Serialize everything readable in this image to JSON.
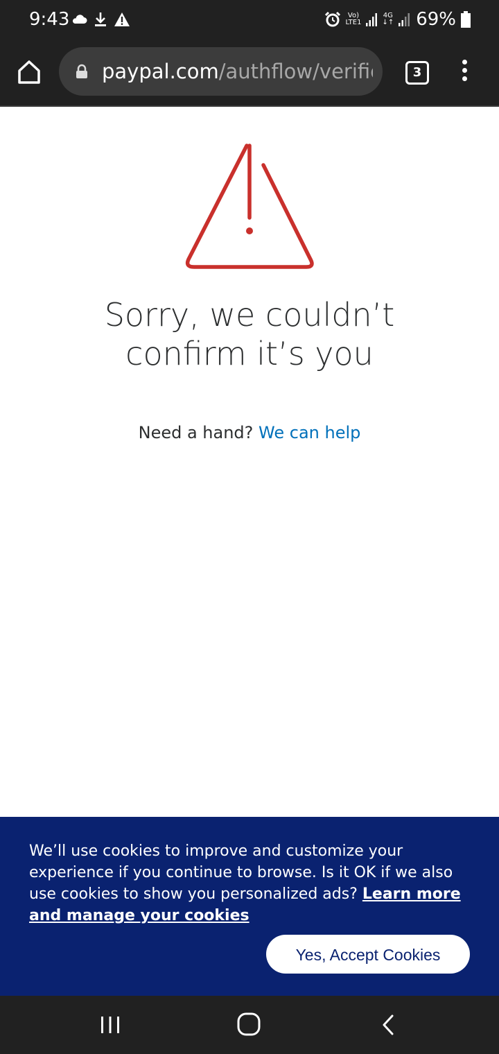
{
  "status_bar": {
    "time": "9:43",
    "network_label_top": "Vo)",
    "network_label_bottom": "LTE1",
    "network2_label_top": "4G",
    "battery_percent": "69%"
  },
  "browser": {
    "url_domain": "paypal.com",
    "url_path": "/authflow/verific",
    "tab_count": "3"
  },
  "main": {
    "headline_line1": "Sorry, we couldn’t",
    "headline_line2": "confirm it’s you",
    "help_prompt": "Need a hand?",
    "help_link": "We can help",
    "warning_color": "#c9302c"
  },
  "cookie_banner": {
    "text": "We’ll use cookies to improve and customize your experience if you continue to browse. Is it OK if we also use cookies to show you personalized ads?",
    "link_text": "Learn more and manage your cookies",
    "accept_label": "Yes, Accept Cookies",
    "background_color": "#0a2270"
  },
  "icons": {
    "status_left": [
      "cloud-icon",
      "download-icon",
      "warning-icon"
    ],
    "status_right": [
      "alarm-icon",
      "signal-icon",
      "battery-icon"
    ],
    "browser": [
      "home-icon",
      "lock-icon",
      "tabs-icon",
      "menu-icon"
    ],
    "nav": [
      "recents-icon",
      "home-icon",
      "back-icon"
    ]
  }
}
